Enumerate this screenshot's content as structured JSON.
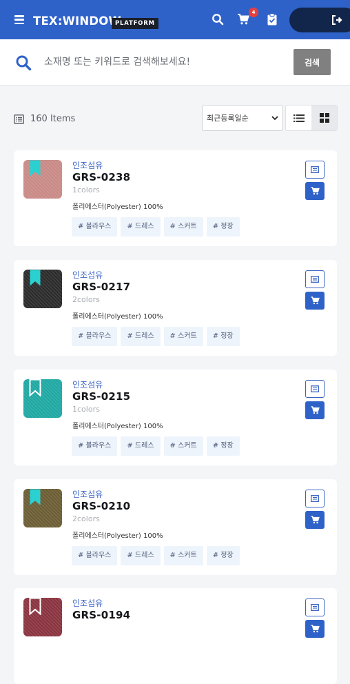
{
  "header": {
    "logo": "TEX:WINDOW",
    "platform": "PLATFORM",
    "cart_count": "4"
  },
  "search": {
    "placeholder": "소재명 또는 키워드로 검색해보세요!",
    "button": "검색"
  },
  "toolbar": {
    "count": "160 Items",
    "sort_selected": "최근등록일순"
  },
  "items": [
    {
      "category": "인조섬유",
      "code": "GRS-0238",
      "colors": "1colors",
      "material": "폴리에스터(Polyester) 100%",
      "tags": [
        "# 블라우스",
        "# 드레스",
        "# 스커트",
        "# 정장"
      ],
      "swatch": "#c98a86",
      "bookmarked": true
    },
    {
      "category": "인조섬유",
      "code": "GRS-0217",
      "colors": "2colors",
      "material": "폴리에스터(Polyester) 100%",
      "tags": [
        "# 블라우스",
        "# 드레스",
        "# 스커트",
        "# 정장"
      ],
      "swatch": "#2b2b2b",
      "bookmarked": true
    },
    {
      "category": "인조섬유",
      "code": "GRS-0215",
      "colors": "1colors",
      "material": "폴리에스터(Polyester) 100%",
      "tags": [
        "# 블라우스",
        "# 드레스",
        "# 스커트",
        "# 정장"
      ],
      "swatch": "#1fa8a3",
      "bookmarked": false
    },
    {
      "category": "인조섬유",
      "code": "GRS-0210",
      "colors": "2colors",
      "material": "폴리에스터(Polyester) 100%",
      "tags": [
        "# 블라우스",
        "# 드레스",
        "# 스커트",
        "# 정장"
      ],
      "swatch": "#6b5d34",
      "bookmarked": true
    },
    {
      "category": "인조섬유",
      "code": "GRS-0194",
      "colors": "",
      "material": "",
      "tags": [],
      "swatch": "#8a3440",
      "bookmarked": false
    }
  ],
  "colors": {
    "brand": "#2f62c9",
    "bookmark": "#2ad1d0",
    "badge": "#e5403d"
  },
  "icons": [
    "menu-icon",
    "search-icon",
    "cart-icon",
    "clipboard-icon",
    "logout-icon",
    "list-icon",
    "grid-icon",
    "bookmark-icon",
    "sample-icon"
  ]
}
